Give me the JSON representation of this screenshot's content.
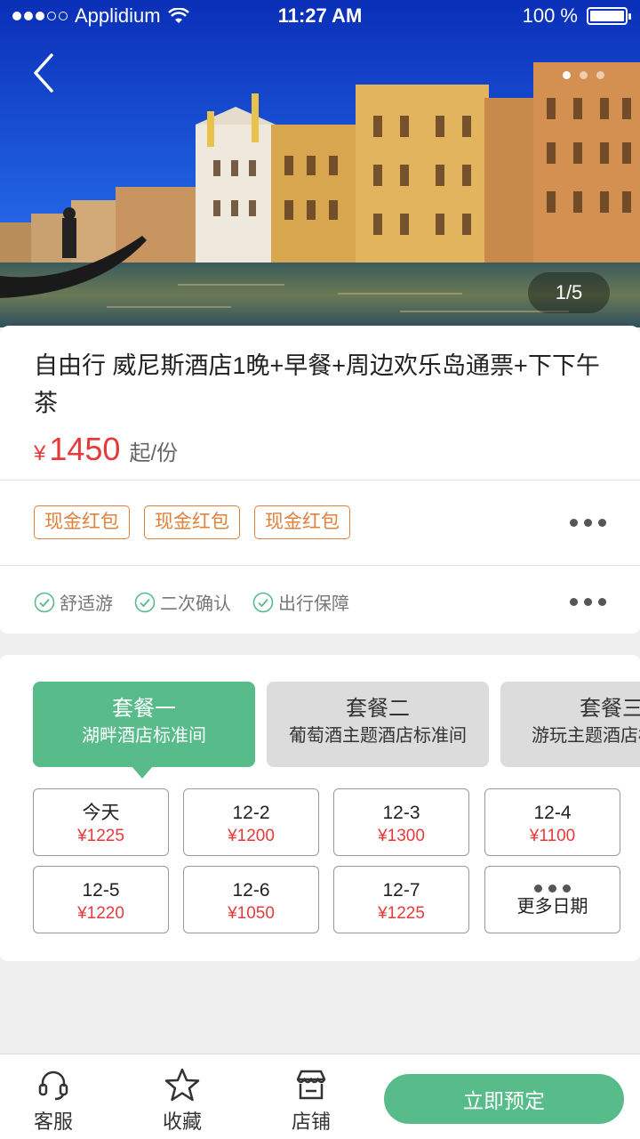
{
  "status_bar": {
    "carrier": "Applidium",
    "time": "11:27 AM",
    "battery": "100 %"
  },
  "hero": {
    "image_counter": "1/5",
    "back_icon": "chevron-left-icon"
  },
  "product": {
    "title": "自由行 威尼斯酒店1晚+早餐+周边欢乐岛通票+下下午茶",
    "currency": "¥",
    "price": "1450",
    "price_unit": "起/份"
  },
  "coupons": [
    "现金红包",
    "现金红包",
    "现金红包"
  ],
  "features": [
    "舒适游",
    "二次确认",
    "出行保障"
  ],
  "packages": [
    {
      "name": "套餐一",
      "desc": "湖畔酒店标准间",
      "active": true
    },
    {
      "name": "套餐二",
      "desc": "葡萄酒主题酒店标准间",
      "active": false
    },
    {
      "name": "套餐三",
      "desc": "游玩主题酒店标准间",
      "active": false
    }
  ],
  "dates": [
    {
      "date": "今天",
      "price": "¥1225"
    },
    {
      "date": "12-2",
      "price": "¥1200"
    },
    {
      "date": "12-3",
      "price": "¥1300"
    },
    {
      "date": "12-4",
      "price": "¥1100"
    },
    {
      "date": "12-5",
      "price": "¥1220"
    },
    {
      "date": "12-6",
      "price": "¥1050"
    },
    {
      "date": "12-7",
      "price": "¥1225"
    }
  ],
  "more_dates_label": "更多日期",
  "tabbar": {
    "service": "客服",
    "favorite": "收藏",
    "store": "店铺",
    "book": "立即预定"
  },
  "colors": {
    "accent": "#57bb8a",
    "price": "#e63a3a",
    "coupon": "#e0813c"
  }
}
